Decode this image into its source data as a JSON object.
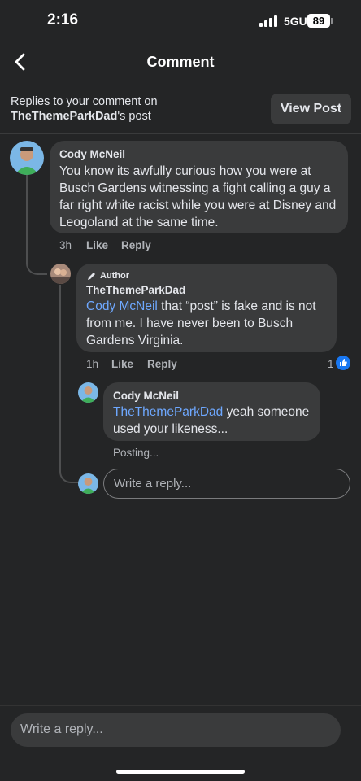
{
  "status_bar": {
    "time": "2:16",
    "network": "5GUC",
    "battery": "89"
  },
  "nav": {
    "title": "Comment",
    "back_icon": "chevron-left-icon"
  },
  "header": {
    "line1": "Replies to your comment on",
    "post_owner": "TheThemeParkDad",
    "post_suffix": "'s post",
    "view_post_label": "View Post"
  },
  "comments": [
    {
      "author": "Cody McNeil",
      "text": "You know its awfully curious how you were at Busch Gardens witnessing a fight calling a guy a far right white racist while you were at Disney and Leogoland at the same time.",
      "time": "3h",
      "like": "Like",
      "reply": "Reply"
    },
    {
      "badge": "Author",
      "author": "TheThemeParkDad",
      "mention": "Cody McNeil",
      "text": " that “post” is fake and is not from me. I have never been to Busch Gardens Virginia.",
      "time": "1h",
      "like": "Like",
      "reply": "Reply",
      "reaction_count": "1"
    },
    {
      "author": "Cody McNeil",
      "mention": "TheThemeParkDad",
      "text": " yeah someone used your likeness...",
      "status": "Posting..."
    }
  ],
  "inline_reply_placeholder": "Write a reply...",
  "bottom_reply_placeholder": "Write a reply...",
  "colors": {
    "background": "#242526",
    "bubble": "#3a3b3c",
    "mention": "#6ea8ff",
    "like_blue": "#1877f2"
  }
}
